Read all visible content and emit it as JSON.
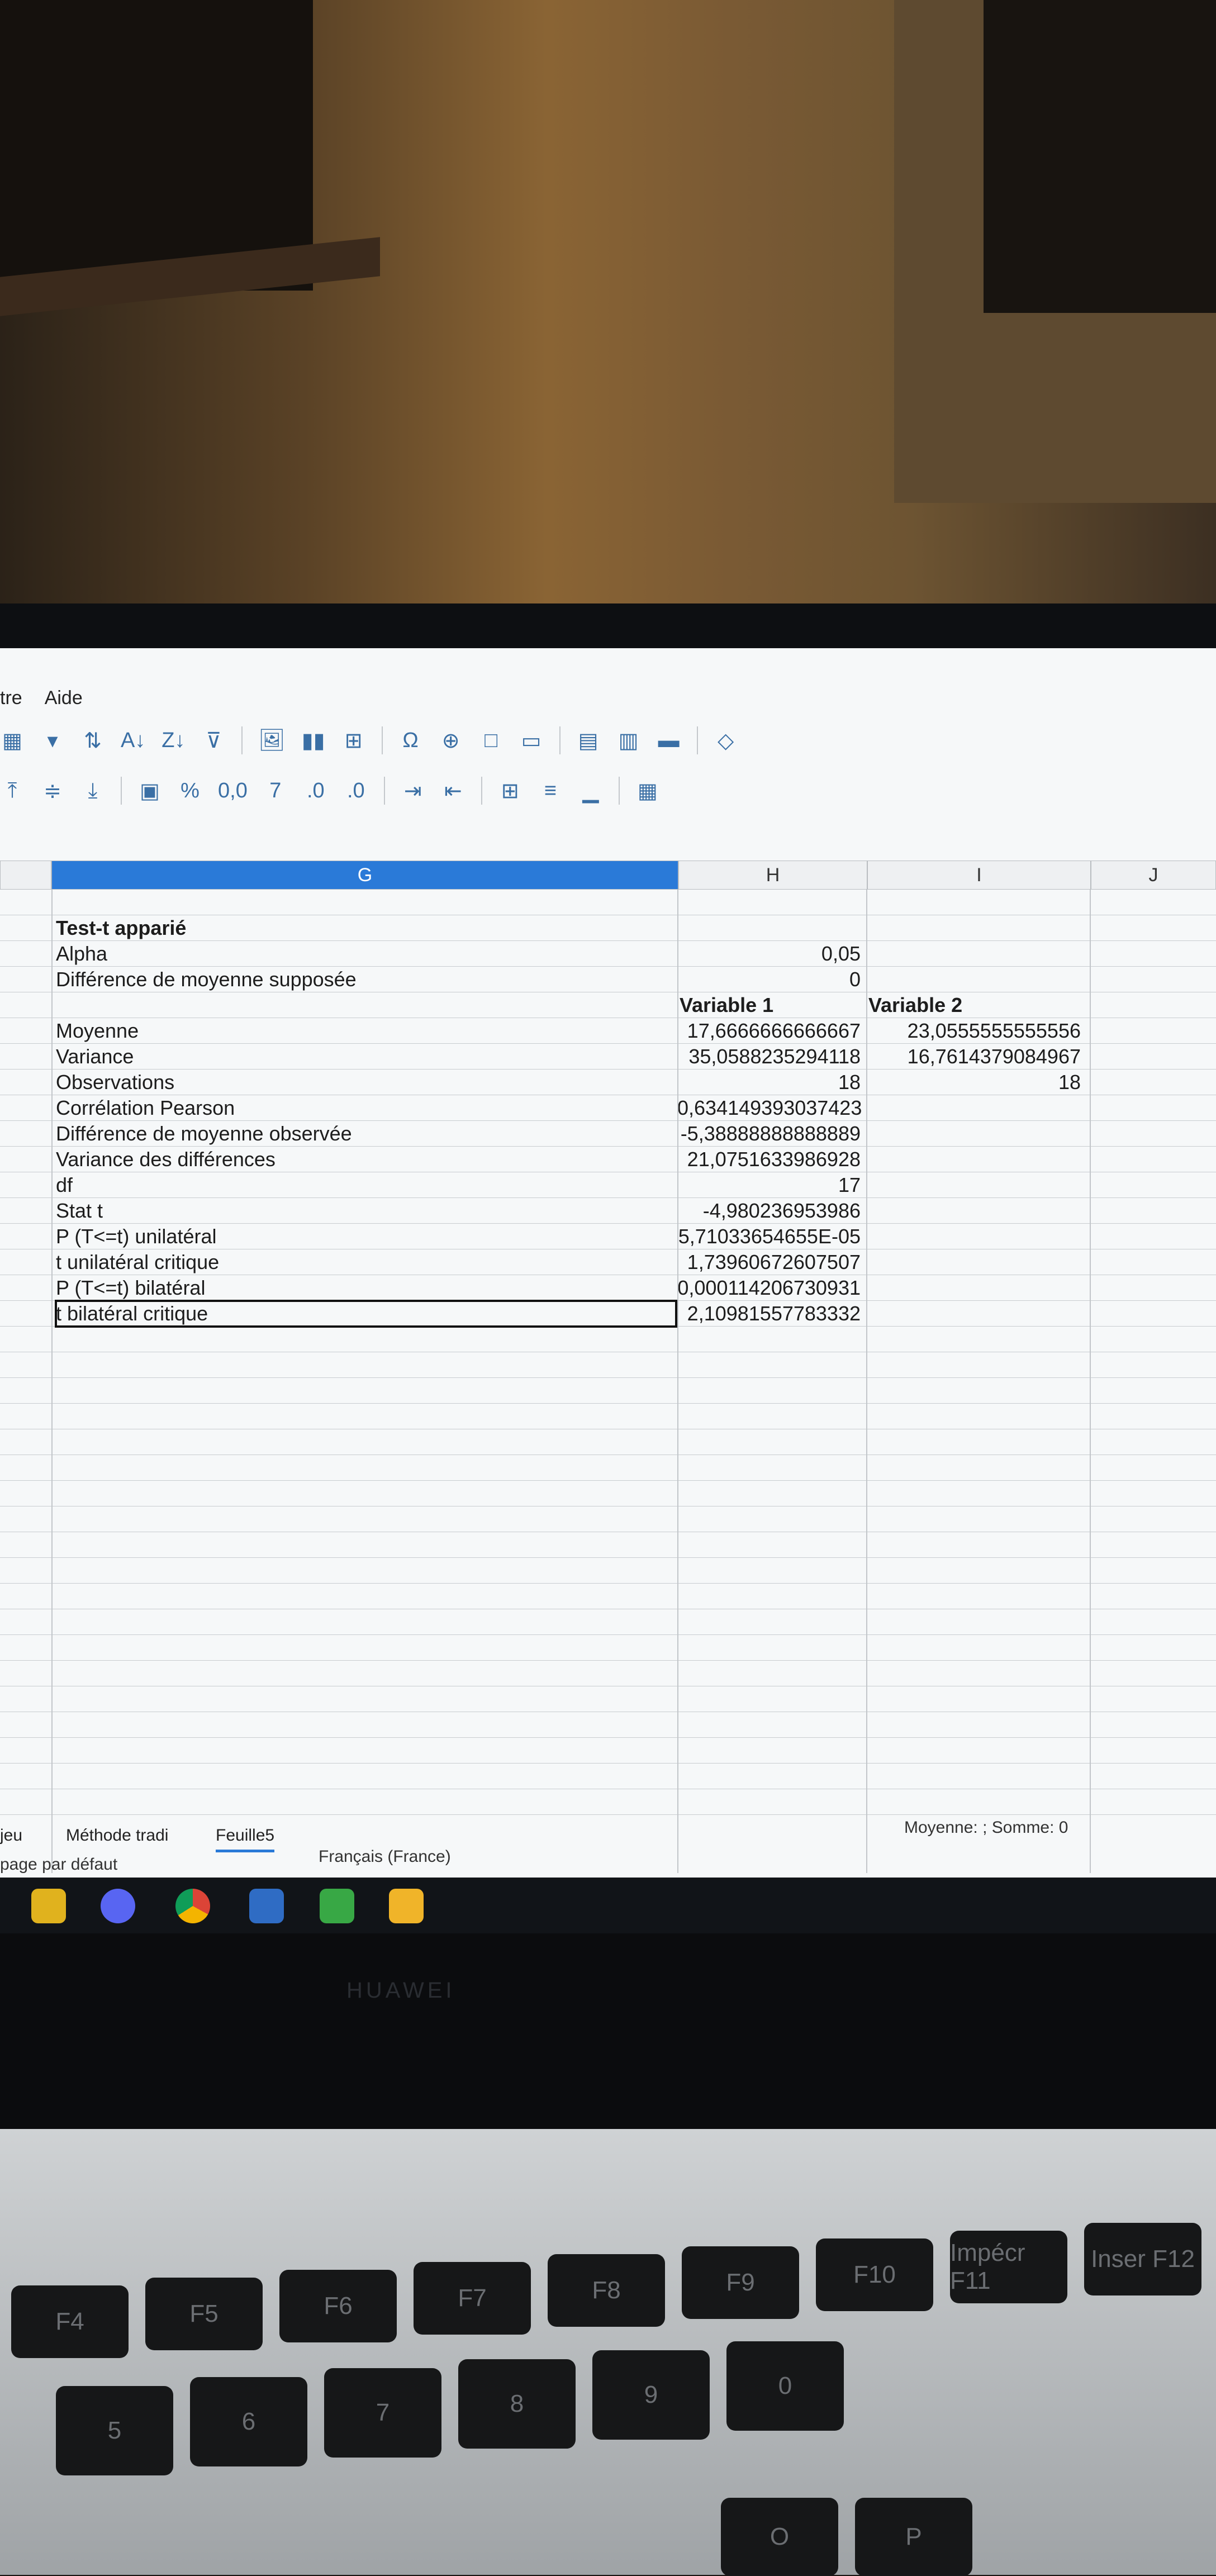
{
  "menu": {
    "items": [
      "tre",
      "Aide"
    ]
  },
  "toolbar": {
    "row1": [
      "table-icon",
      "dropdown-icon",
      "sort-icon",
      "sort-ascending-icon",
      "sort-descending-icon",
      "autofilter-icon",
      "image-icon",
      "chart-icon",
      "pivot-table-icon",
      "special-character-icon",
      "hyperlink-icon",
      "comment-icon",
      "header-footer-icon",
      "define-print-area-icon",
      "freeze-rows-columns-icon",
      "split-window-icon",
      "show-draw-functions-icon"
    ],
    "row2_labels": [
      "%",
      "0,0",
      "7"
    ]
  },
  "grid": {
    "columns": [
      "G",
      "H",
      "I",
      "J"
    ],
    "rows": [
      {
        "label": "",
        "h": "",
        "i": ""
      },
      {
        "label": "Test-t apparié",
        "h": "",
        "i": "",
        "bold_label": true
      },
      {
        "label": "Alpha",
        "h": "0,05",
        "i": ""
      },
      {
        "label": "Différence de moyenne supposée",
        "h": "0",
        "i": ""
      },
      {
        "label": "",
        "h": "Variable 1",
        "i": "Variable 2",
        "header": true
      },
      {
        "label": "Moyenne",
        "h": "17,6666666666667",
        "i": "23,0555555555556"
      },
      {
        "label": "Variance",
        "h": "35,0588235294118",
        "i": "16,7614379084967"
      },
      {
        "label": "Observations",
        "h": "18",
        "i": "18"
      },
      {
        "label": "Corrélation Pearson",
        "h": "0,634149393037423",
        "i": ""
      },
      {
        "label": "Différence de moyenne observée",
        "h": "-5,38888888888889",
        "i": ""
      },
      {
        "label": "Variance des différences",
        "h": "21,0751633986928",
        "i": ""
      },
      {
        "label": "df",
        "h": "17",
        "i": ""
      },
      {
        "label": "Stat t",
        "h": "-4,980236953986",
        "i": ""
      },
      {
        "label": "P (T<=t) unilatéral",
        "h": "5,71033654655E-05",
        "i": ""
      },
      {
        "label": "t unilatéral critique",
        "h": "1,73960672607507",
        "i": ""
      },
      {
        "label": "P (T<=t) bilatéral",
        "h": "0,000114206730931",
        "i": ""
      },
      {
        "label": "t bilatéral critique",
        "h": "2,10981557783332",
        "i": ""
      }
    ]
  },
  "sheet_tabs": [
    "jeu",
    "Méthode tradi",
    "Feuille5"
  ],
  "status": {
    "page_style": "page par défaut",
    "language": "Français (France)",
    "summary": "Moyenne: ; Somme: 0"
  },
  "laptop": {
    "brand": "HUAWEI"
  },
  "keyboard": {
    "fn_keys": [
      "F4",
      "F5",
      "F6",
      "F7",
      "F8",
      "F9",
      "F10",
      "Impécr F11",
      "Inser F12"
    ],
    "num_keys": [
      "5",
      "6",
      "7",
      "8",
      "9",
      "0"
    ],
    "letters": [
      "O",
      "P"
    ]
  }
}
